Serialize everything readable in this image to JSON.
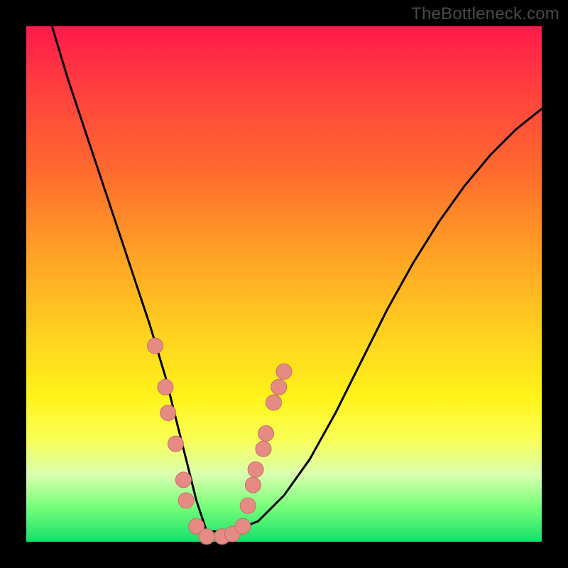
{
  "watermark": "TheBottleneck.com",
  "colors": {
    "frame": "#000000",
    "curve": "#000000",
    "marker_fill": "#e58b84",
    "marker_stroke": "#c76f69"
  },
  "chart_data": {
    "type": "line",
    "title": "",
    "xlabel": "",
    "ylabel": "",
    "xlim": [
      0,
      100
    ],
    "ylim": [
      0,
      100
    ],
    "grid": false,
    "legend": false,
    "note": "V-shaped bottleneck curve; x relative horizontal position 0-100, y relative height 0-100 (0 = bottom/green, 100 = top/red). Markers cluster near the trough.",
    "series": [
      {
        "name": "bottleneck-curve",
        "x": [
          5,
          8,
          12,
          16,
          20,
          24,
          27,
          29,
          31,
          33,
          35,
          40,
          45,
          50,
          55,
          60,
          65,
          70,
          75,
          80,
          85,
          90,
          95,
          100
        ],
        "y": [
          100,
          90,
          78,
          66,
          54,
          42,
          32,
          24,
          16,
          8,
          2,
          2,
          4,
          9,
          16,
          25,
          35,
          45,
          54,
          62,
          69,
          75,
          80,
          84
        ]
      }
    ],
    "markers": [
      {
        "x": 25,
        "y": 38
      },
      {
        "x": 27,
        "y": 30
      },
      {
        "x": 27.5,
        "y": 25
      },
      {
        "x": 29,
        "y": 19
      },
      {
        "x": 30.5,
        "y": 12
      },
      {
        "x": 31,
        "y": 8
      },
      {
        "x": 33,
        "y": 3
      },
      {
        "x": 35,
        "y": 1
      },
      {
        "x": 38,
        "y": 1
      },
      {
        "x": 40,
        "y": 1.5
      },
      {
        "x": 42,
        "y": 3
      },
      {
        "x": 43,
        "y": 7
      },
      {
        "x": 44,
        "y": 11
      },
      {
        "x": 44.5,
        "y": 14
      },
      {
        "x": 46,
        "y": 18
      },
      {
        "x": 46.5,
        "y": 21
      },
      {
        "x": 48,
        "y": 27
      },
      {
        "x": 49,
        "y": 30
      },
      {
        "x": 50,
        "y": 33
      }
    ]
  }
}
